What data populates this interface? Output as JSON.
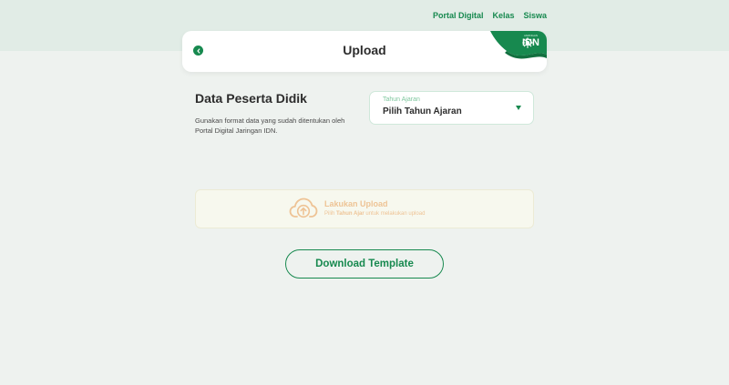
{
  "nav": {
    "items": [
      "Portal Digital",
      "Kelas",
      "Siswa"
    ]
  },
  "header": {
    "title": "Upload",
    "logo_text": "IDN",
    "logo_subtext": "JARINGAN"
  },
  "section": {
    "title": "Data Peserta Didik",
    "description": "Gunakan format data yang sudah ditentukan oleh Portal Digital Jaringan IDN."
  },
  "select": {
    "label": "Tahun Ajaran",
    "value": "Pilih Tahun Ajaran"
  },
  "upload": {
    "title": "Lakukan Upload",
    "sub_prefix": "Pilih",
    "sub_bold": "Tahun Ajar",
    "sub_suffix": "untuk melakukan upload"
  },
  "download": {
    "label": "Download Template"
  },
  "colors": {
    "primary": "#17894f",
    "upload_accent": "#eec395",
    "background": "#eef2ef"
  }
}
